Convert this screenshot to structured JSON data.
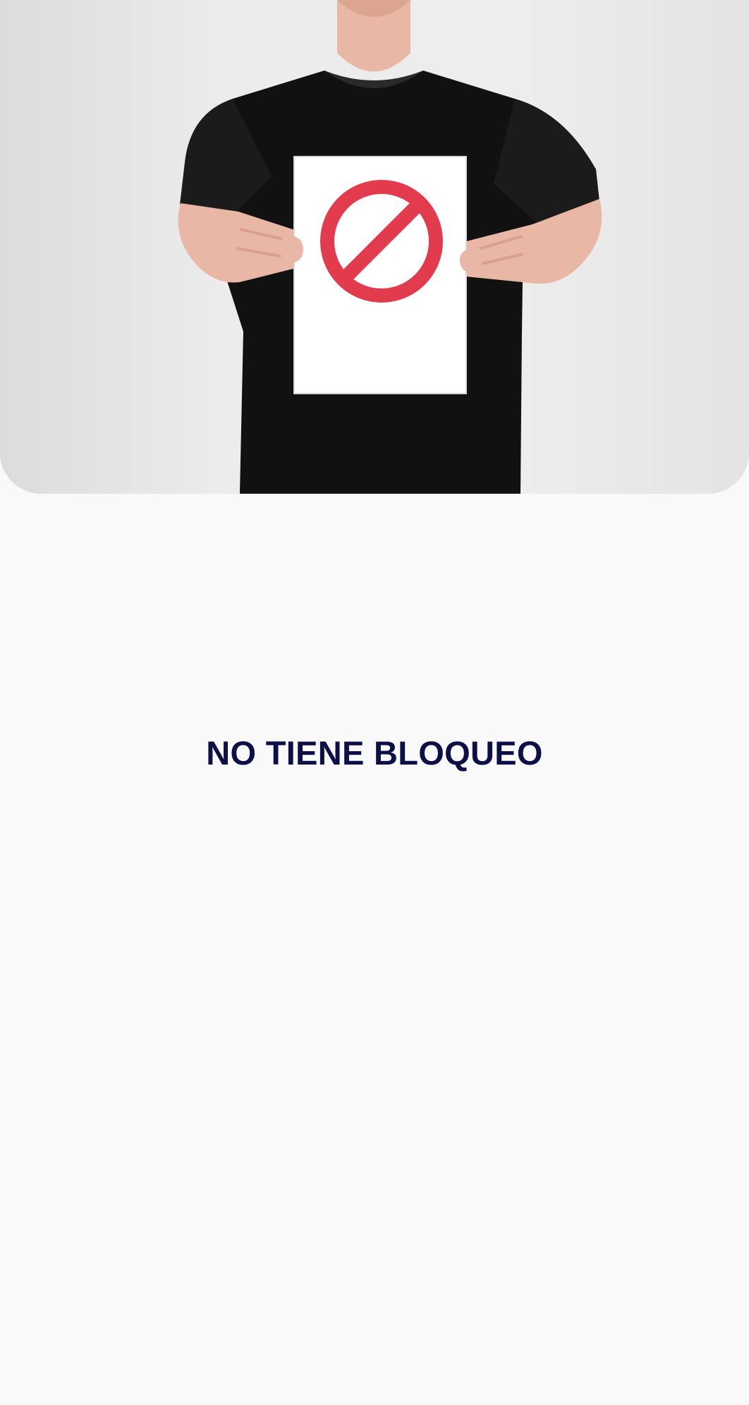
{
  "screen": {
    "message": "NO TIENE BLOQUEO",
    "colors": {
      "background": "#f9f9f9",
      "title": "#0d0f47",
      "prohibition_sign": "#e23b4e"
    },
    "hero_image": {
      "icon": "prohibited-sign-icon"
    }
  }
}
